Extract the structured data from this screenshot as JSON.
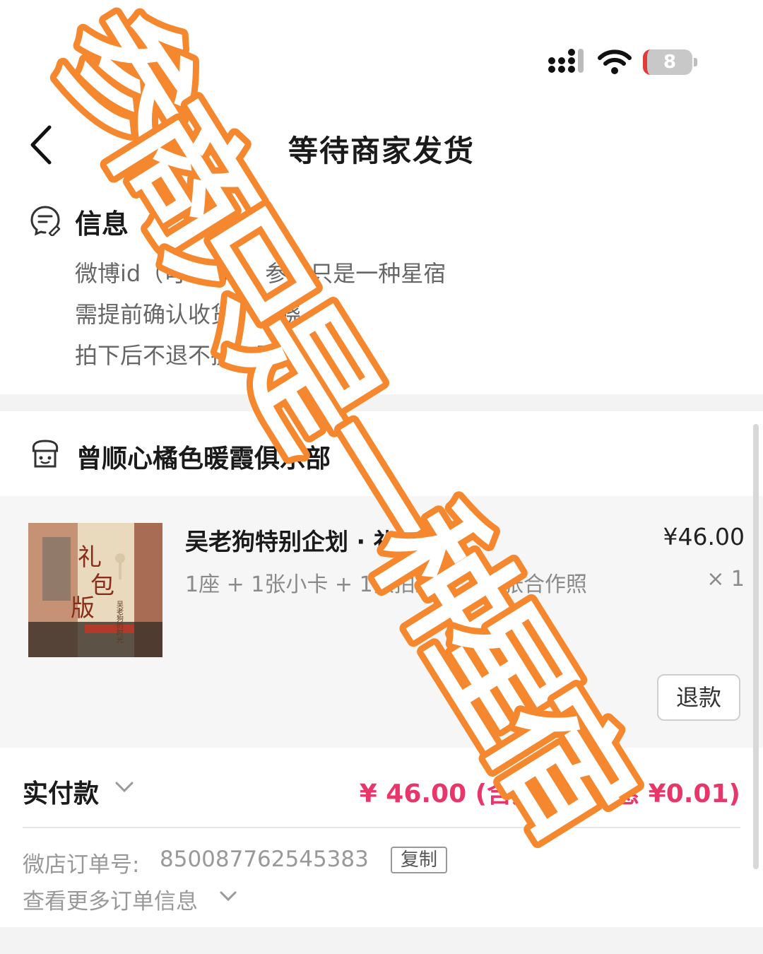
{
  "status_bar": {
    "battery_level": "8",
    "battery_color": "#e33a3a"
  },
  "nav": {
    "title": "等待商家发货",
    "back_icon": "chevron-left-icon"
  },
  "info": {
    "title": "信息",
    "lines": [
      "微博id（可填写）：参商只是一种星宿",
      "需提前确认收货：拂晓",
      "拍下后不退不换：已知晓"
    ]
  },
  "shop": {
    "name": "曾顺心橘色暖霞俱乐部"
  },
  "product": {
    "title": "吴老狗特别企划 · 礼包版",
    "spec": "1座 + 1张小卡 + 1张拍立得 + 1张合作照",
    "price": "¥46.00",
    "qty": "× 1",
    "refund_label": "退款",
    "thumb_text": "礼包版",
    "thumb_subtext": "吴老狗的时光"
  },
  "payment": {
    "label": "实付款",
    "amount": "¥ 46.00 (含运费，优惠 ¥0.01)"
  },
  "order": {
    "label": "微店订单号:",
    "number": "850087762545383",
    "copy_label": "复制",
    "more_label": "查看更多订单信息"
  },
  "watermark": {
    "text": "参商只是一种星宿",
    "color": "#f5882e"
  },
  "colors": {
    "accent_red": "#e8356a",
    "band_gray": "#f3f3f3"
  }
}
